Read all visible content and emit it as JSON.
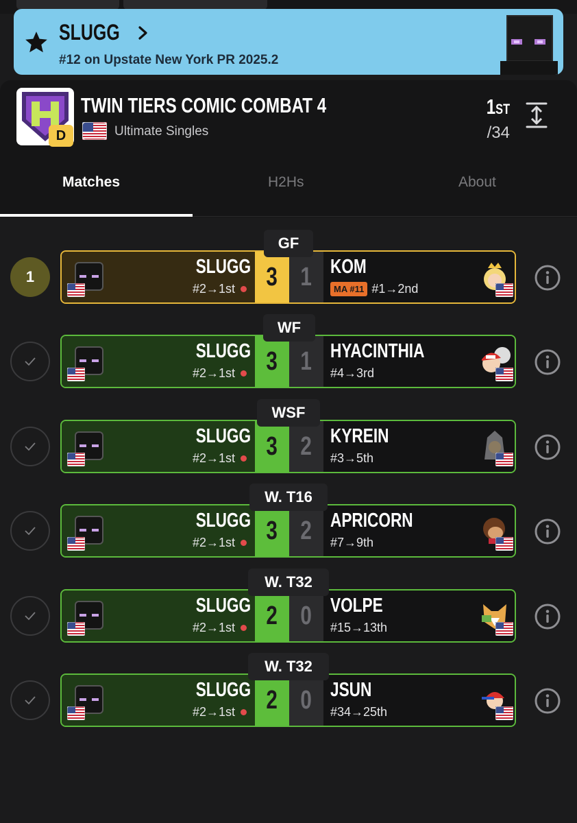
{
  "banner": {
    "player_name": "SLUGG",
    "ranking": "#12 on Upstate New York PR 2025.2"
  },
  "tournament": {
    "title": "TWIN TIERS COMIC COMBAT 4",
    "tier_badge": "D",
    "event": "Ultimate Singles",
    "placement_number": "1",
    "placement_suffix": "ST",
    "entrants": "/34"
  },
  "tabs": {
    "matches": "Matches",
    "h2hs": "H2Hs",
    "about": "About"
  },
  "matches": [
    {
      "round": "GF",
      "status": "1",
      "player": "SLUGG",
      "player_seed": "#2→1st",
      "player_score": "3",
      "opponent": "KOM",
      "opp_badge": "MA #11",
      "opp_seed": "#1→2nd",
      "opp_score": "1",
      "style": "gold",
      "opp_character": "peach-icon"
    },
    {
      "round": "WF",
      "status": "check",
      "player": "SLUGG",
      "player_seed": "#2→1st",
      "player_score": "3",
      "opponent": "HYACINTHIA",
      "opp_badge": "",
      "opp_seed": "#4→3rd",
      "opp_score": "1",
      "style": "green",
      "opp_character": "pokemon-trainer-icon"
    },
    {
      "round": "WSF",
      "status": "check",
      "player": "SLUGG",
      "player_seed": "#2→1st",
      "player_score": "3",
      "opponent": "KYREIN",
      "opp_badge": "",
      "opp_seed": "#3→5th",
      "opp_score": "2",
      "style": "green",
      "opp_character": "ganondorf-icon"
    },
    {
      "round": "W. T16",
      "status": "check",
      "player": "SLUGG",
      "player_seed": "#2→1st",
      "player_score": "3",
      "opponent": "APRICORN",
      "opp_badge": "",
      "opp_seed": "#7→9th",
      "opp_score": "2",
      "style": "green",
      "opp_character": "donkey-kong-icon"
    },
    {
      "round": "W. T32",
      "status": "check",
      "player": "SLUGG",
      "player_seed": "#2→1st",
      "player_score": "2",
      "opponent": "VOLPE",
      "opp_badge": "",
      "opp_seed": "#15→13th",
      "opp_score": "0",
      "style": "green",
      "opp_character": "fox-icon"
    },
    {
      "round": "W. T32",
      "status": "check",
      "player": "SLUGG",
      "player_seed": "#2→1st",
      "player_score": "2",
      "opponent": "JSUN",
      "opp_badge": "",
      "opp_seed": "#34→25th",
      "opp_score": "0",
      "style": "green",
      "opp_character": "ness-icon"
    }
  ],
  "colors": {
    "banner": "#7fcbec",
    "win_gold": "#f2c542",
    "win_green": "#5dbd3b",
    "seed_dot": "#e24b4b",
    "ma_badge": "#e8702a"
  }
}
